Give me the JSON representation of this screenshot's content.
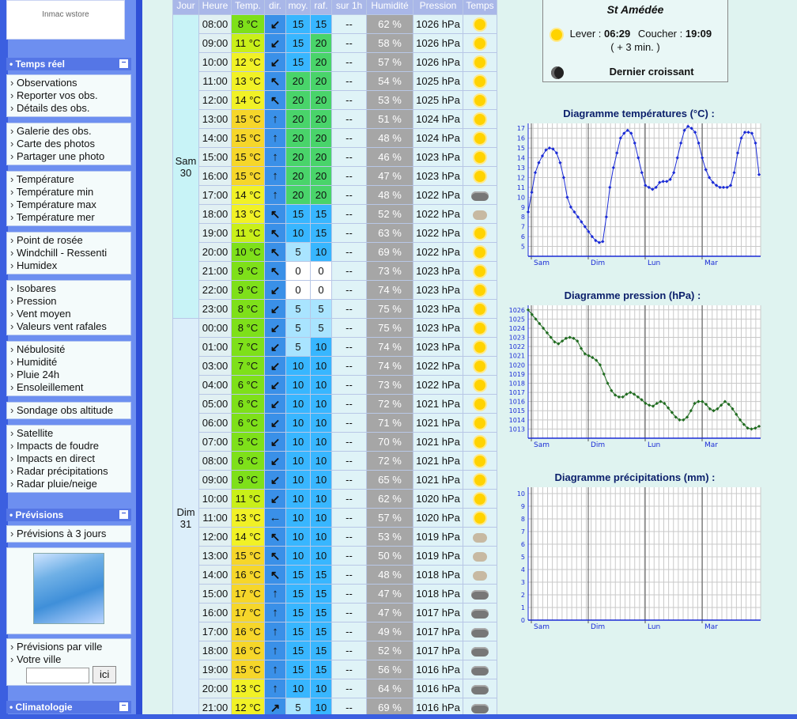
{
  "sidebar": {
    "logo_text": "Inmac wstore",
    "sections": [
      {
        "title": "Temps réel"
      },
      {
        "title": "Prévisions"
      },
      {
        "title": "Climatologie"
      }
    ],
    "groups": [
      [
        "Observations",
        "Reporter vos obs.",
        "Détails des obs."
      ],
      [
        "Galerie des obs.",
        "Carte des photos",
        "Partager une photo"
      ],
      [
        "Température",
        "Température min",
        "Température max",
        "Température mer"
      ],
      [
        "Point de rosée",
        "Windchill - Ressenti",
        "Humidex"
      ],
      [
        "Isobares",
        "Pression",
        "Vent moyen",
        "Valeurs vent rafales"
      ],
      [
        "Nébulosité",
        "Humidité",
        "Pluie 24h",
        "Ensoleillement"
      ],
      [
        "Sondage obs altitude"
      ],
      [
        "Satellite",
        "Impacts de foudre",
        "Impacts en direct",
        "Radar précipitations",
        "Radar pluie/neige"
      ],
      [
        "Prévisions à 3 jours"
      ],
      [
        "Prévisions par ville",
        "Votre ville"
      ]
    ],
    "search_button": "ici"
  },
  "table": {
    "headers": [
      "Jour",
      "Heure",
      "Temp.",
      "dir.",
      "moy.",
      "raf.",
      "sur 1h",
      "Humidité",
      "Pression",
      "Temps"
    ],
    "days": [
      {
        "label": "Sam\n30"
      },
      {
        "label": "Dim\n31"
      }
    ],
    "rows": [
      [
        "08:00",
        "8 °C",
        "↙",
        "15",
        "15",
        "--",
        "62 %",
        "1026 hPa",
        "sun"
      ],
      [
        "09:00",
        "11 °C",
        "↙",
        "15",
        "20",
        "--",
        "58 %",
        "1026 hPa",
        "sun"
      ],
      [
        "10:00",
        "12 °C",
        "↙",
        "15",
        "20",
        "--",
        "57 %",
        "1026 hPa",
        "sun"
      ],
      [
        "11:00",
        "13 °C",
        "↖",
        "20",
        "20",
        "--",
        "54 %",
        "1025 hPa",
        "sun"
      ],
      [
        "12:00",
        "14 °C",
        "↖",
        "20",
        "20",
        "--",
        "53 %",
        "1025 hPa",
        "sun"
      ],
      [
        "13:00",
        "15 °C",
        "↑",
        "20",
        "20",
        "--",
        "51 %",
        "1024 hPa",
        "sun"
      ],
      [
        "14:00",
        "15 °C",
        "↑",
        "20",
        "20",
        "--",
        "48 %",
        "1024 hPa",
        "sun"
      ],
      [
        "15:00",
        "15 °C",
        "↑",
        "20",
        "20",
        "--",
        "46 %",
        "1023 hPa",
        "sun"
      ],
      [
        "16:00",
        "15 °C",
        "↑",
        "20",
        "20",
        "--",
        "47 %",
        "1023 hPa",
        "sun"
      ],
      [
        "17:00",
        "14 °C",
        "↑",
        "20",
        "20",
        "--",
        "48 %",
        "1022 hPa",
        "cloud"
      ],
      [
        "18:00",
        "13 °C",
        "↖",
        "15",
        "15",
        "--",
        "52 %",
        "1022 hPa",
        "mix"
      ],
      [
        "19:00",
        "11 °C",
        "↖",
        "10",
        "15",
        "--",
        "63 %",
        "1022 hPa",
        "sun"
      ],
      [
        "20:00",
        "10 °C",
        "↖",
        "5",
        "10",
        "--",
        "69 %",
        "1022 hPa",
        "sun"
      ],
      [
        "21:00",
        "9 °C",
        "↖",
        "0",
        "0",
        "--",
        "73 %",
        "1023 hPa",
        "sun"
      ],
      [
        "22:00",
        "9 °C",
        "↙",
        "0",
        "0",
        "--",
        "74 %",
        "1023 hPa",
        "sun"
      ],
      [
        "23:00",
        "8 °C",
        "↙",
        "5",
        "5",
        "--",
        "75 %",
        "1023 hPa",
        "sun"
      ],
      [
        "00:00",
        "8 °C",
        "↙",
        "5",
        "5",
        "--",
        "75 %",
        "1023 hPa",
        "sun"
      ],
      [
        "01:00",
        "7 °C",
        "↙",
        "5",
        "10",
        "--",
        "74 %",
        "1023 hPa",
        "sun"
      ],
      [
        "03:00",
        "7 °C",
        "↙",
        "10",
        "10",
        "--",
        "74 %",
        "1022 hPa",
        "sun"
      ],
      [
        "04:00",
        "6 °C",
        "↙",
        "10",
        "10",
        "--",
        "73 %",
        "1022 hPa",
        "sun"
      ],
      [
        "05:00",
        "6 °C",
        "↙",
        "10",
        "10",
        "--",
        "72 %",
        "1021 hPa",
        "sun"
      ],
      [
        "06:00",
        "6 °C",
        "↙",
        "10",
        "10",
        "--",
        "71 %",
        "1021 hPa",
        "sun"
      ],
      [
        "07:00",
        "5 °C",
        "↙",
        "10",
        "10",
        "--",
        "70 %",
        "1021 hPa",
        "sun"
      ],
      [
        "08:00",
        "6 °C",
        "↙",
        "10",
        "10",
        "--",
        "72 %",
        "1021 hPa",
        "sun"
      ],
      [
        "09:00",
        "9 °C",
        "↙",
        "10",
        "10",
        "--",
        "65 %",
        "1021 hPa",
        "sun"
      ],
      [
        "10:00",
        "11 °C",
        "↙",
        "10",
        "10",
        "--",
        "62 %",
        "1020 hPa",
        "sun"
      ],
      [
        "11:00",
        "13 °C",
        "←",
        "10",
        "10",
        "--",
        "57 %",
        "1020 hPa",
        "sun"
      ],
      [
        "12:00",
        "14 °C",
        "↖",
        "10",
        "10",
        "--",
        "53 %",
        "1019 hPa",
        "mix"
      ],
      [
        "13:00",
        "15 °C",
        "↖",
        "10",
        "10",
        "--",
        "50 %",
        "1019 hPa",
        "mix"
      ],
      [
        "14:00",
        "16 °C",
        "↖",
        "15",
        "15",
        "--",
        "48 %",
        "1018 hPa",
        "mix"
      ],
      [
        "15:00",
        "17 °C",
        "↑",
        "15",
        "15",
        "--",
        "47 %",
        "1018 hPa",
        "cloud"
      ],
      [
        "16:00",
        "17 °C",
        "↑",
        "15",
        "15",
        "--",
        "47 %",
        "1017 hPa",
        "cloud"
      ],
      [
        "17:00",
        "16 °C",
        "↑",
        "15",
        "15",
        "--",
        "49 %",
        "1017 hPa",
        "cloud"
      ],
      [
        "18:00",
        "16 °C",
        "↑",
        "15",
        "15",
        "--",
        "52 %",
        "1017 hPa",
        "cloud"
      ],
      [
        "19:00",
        "15 °C",
        "↑",
        "15",
        "15",
        "--",
        "56 %",
        "1016 hPa",
        "cloud"
      ],
      [
        "20:00",
        "13 °C",
        "↑",
        "10",
        "10",
        "--",
        "64 %",
        "1016 hPa",
        "cloud"
      ],
      [
        "21:00",
        "12 °C",
        "↗",
        "5",
        "10",
        "--",
        "69 %",
        "1016 hPa",
        "cloud"
      ]
    ]
  },
  "sun_box": {
    "saint": "St Amédée",
    "lever_label": "Lever :",
    "lever_time": "06:29",
    "coucher_label": "Coucher :",
    "coucher_time": "19:09",
    "gain": "( + 3 min. )",
    "moon_phase": "Dernier croissant"
  },
  "chart_data": [
    {
      "type": "line",
      "title": "Diagramme températures (°C) :",
      "x_labels": [
        "Sam",
        "Dim",
        "Lun",
        "Mar"
      ],
      "y_ticks": [
        5,
        6,
        7,
        8,
        9,
        10,
        11,
        12,
        13,
        14,
        15,
        16,
        17
      ],
      "ylim": [
        4,
        17.5
      ],
      "values": [
        8.5,
        10.5,
        12.5,
        13.5,
        14.2,
        14.8,
        15,
        14.9,
        14.5,
        13.5,
        12,
        10,
        9,
        8.5,
        8,
        7.5,
        7,
        6.5,
        6,
        5.6,
        5.4,
        5.5,
        8,
        11,
        13,
        14.5,
        16,
        16.5,
        16.8,
        16.5,
        15.5,
        14,
        12.5,
        11.2,
        11,
        10.8,
        11,
        11.5,
        11.6,
        11.6,
        11.8,
        12.5,
        14,
        15.5,
        16.8,
        17.2,
        17,
        16.6,
        15.5,
        14,
        12.8,
        12,
        11.5,
        11.2,
        11,
        11,
        11,
        11.2,
        12.5,
        14.5,
        16,
        16.6,
        16.6,
        16.5,
        15.5,
        12.3
      ],
      "color": "#1a2bd6"
    },
    {
      "type": "line",
      "title": "Diagramme pression (hPa) :",
      "x_labels": [
        "Sam",
        "Dim",
        "Lun",
        "Mar"
      ],
      "y_ticks": [
        1013,
        1014,
        1015,
        1016,
        1017,
        1018,
        1019,
        1020,
        1021,
        1022,
        1023,
        1024,
        1025,
        1026
      ],
      "ylim": [
        1012,
        1026.5
      ],
      "values": [
        1026,
        1025.5,
        1025,
        1024.5,
        1024,
        1023.5,
        1023,
        1022.5,
        1022.3,
        1022.6,
        1022.9,
        1023,
        1022.9,
        1022.6,
        1021.8,
        1021.2,
        1021,
        1020.8,
        1020.5,
        1020,
        1019,
        1018,
        1017.2,
        1016.7,
        1016.5,
        1016.5,
        1016.8,
        1017,
        1016.8,
        1016.5,
        1016.2,
        1015.8,
        1015.6,
        1015.5,
        1015.8,
        1016,
        1015.8,
        1015.3,
        1014.8,
        1014.3,
        1014,
        1014,
        1014.3,
        1015,
        1015.8,
        1016,
        1016,
        1015.7,
        1015.2,
        1015,
        1015.2,
        1015.6,
        1016,
        1015.7,
        1015.2,
        1014.6,
        1014,
        1013.5,
        1013.1,
        1013,
        1013.1,
        1013.3
      ],
      "color": "#1f6b1f"
    },
    {
      "type": "bar",
      "title": "Diagramme précipitations (mm) :",
      "x_labels": [
        "Sam",
        "Dim",
        "Lun",
        "Mar"
      ],
      "y_ticks": [
        0,
        1,
        2,
        3,
        4,
        5,
        6,
        7,
        8,
        9,
        10
      ],
      "ylim": [
        0,
        10.5
      ],
      "values": []
    }
  ]
}
